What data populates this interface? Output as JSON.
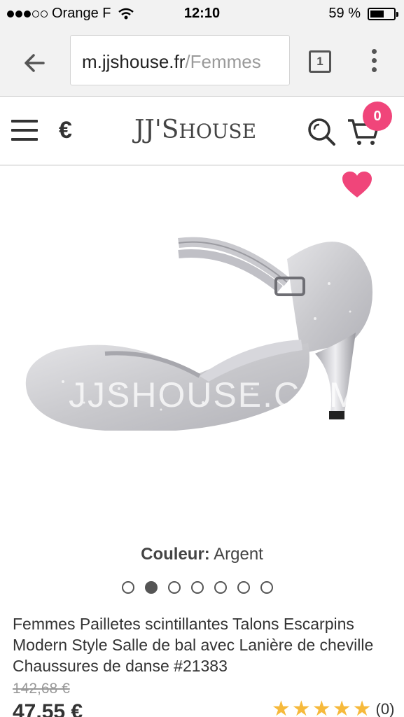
{
  "status_bar": {
    "carrier": "Orange F",
    "time": "12:10",
    "battery": "59 %",
    "battery_level": 0.59,
    "signal_bars": 3,
    "signal_total": 5
  },
  "browser": {
    "url_host": "m.jjshouse.fr",
    "url_path": "/Femmes",
    "tab_count": "1",
    "icons": [
      "back-arrow-icon",
      "tabs-icon",
      "overflow-menu-icon"
    ]
  },
  "header": {
    "currency": "€",
    "logo_main": "JJ'S",
    "logo_sub": "HOUSE",
    "cart_count": "0",
    "icons": [
      "hamburger-icon",
      "search-icon",
      "cart-icon"
    ]
  },
  "product": {
    "watermark": "JJSHOUSE.COM",
    "color_label": "Couleur:",
    "color_value": "Argent",
    "image_count": 7,
    "active_image": 2,
    "title": "Femmes Pailletes scintillantes Talons Escarpins Modern Style Salle de bal avec Lanière de cheville Chaussures de danse #21383",
    "old_price": "142,68 €",
    "price": "47,55 €",
    "rating_stars": 5,
    "rating_count": "(0)",
    "colors": {
      "favorite": "#f0457a",
      "badge": "#f0457a",
      "stars": "#f6b93b"
    }
  }
}
